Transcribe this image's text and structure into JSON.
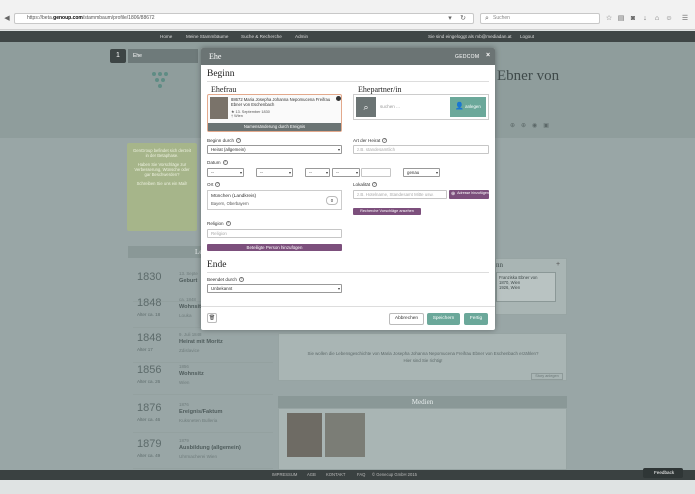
{
  "browser": {
    "url_prefix": "https://beta.",
    "url_domain": "genoup.com",
    "url_path": "/stammbaum/profile/1806/88672",
    "search_placeholder": "Suchen"
  },
  "site_nav": {
    "items": [
      "Home",
      "Meine Stammbäume",
      "Suche & Recherche",
      "Admin"
    ],
    "logged_in_text": "Sie sind eingeloggt als mb@mediadan.at",
    "logout_label": "Logout"
  },
  "background": {
    "step_number": "1",
    "step_label": "Ehe",
    "person_heading": "Ebner von",
    "sidebar_text_1": "GenGroup befindet sich derzeit in der Betaphase.",
    "sidebar_text_2": "Haben Sie Vorschläge zur Verbesserung, Wünsche oder gar Beschwerden?",
    "sidebar_text_3": "Schreiben Sie uns ein Mail!",
    "lebenslauf_heading": "Leb",
    "partner_heading": "nn",
    "partner_card": "Franziska Ebner von",
    "partner_card_date": "1870, Wien",
    "partner_card_date2": "1926, Wien",
    "empty_story": "Sie wollen die Lebensgeschichte von Maria Josepha Johanna Nepomucena Freifrau Ebner von Eschenbach erzählen? Hier sind Sie richtig!",
    "story_edit_label": "Story anlegen",
    "media_heading": "Medien",
    "timeline": [
      {
        "year": "1830",
        "age": "",
        "date": "13. Septe",
        "event": "Geburt",
        "place": ""
      },
      {
        "year": "1848",
        "age": "Alter ca. 18",
        "date": "ca. 1848",
        "event": "Wohnsit",
        "place": "Louka"
      },
      {
        "year": "1848",
        "age": "Alter 17",
        "date": "9. Juli 1848",
        "event": "Heirat mit Moritz",
        "place": "Zdislavice"
      },
      {
        "year": "1856",
        "age": "Alter ca. 26",
        "date": "1856",
        "event": "Wohnsitz",
        "place": "Wien"
      },
      {
        "year": "1876",
        "age": "Alter ca. 46",
        "date": "1876",
        "event": "Ereignis/Faktum",
        "place": "Kuksneten Bulleria"
      },
      {
        "year": "1879",
        "age": "Alter ca. 49",
        "date": "1879",
        "event": "Ausbildung (allgemein)",
        "place": "Uhrmacherei Wien"
      }
    ]
  },
  "modal": {
    "title": "Ehe",
    "brand": "GEDCOM",
    "close": "×",
    "beginn_heading": "Beginn",
    "ehefrau_heading": "Ehefrau",
    "ehefrau_card": {
      "name": "88672 Maria Josepha Johanna Nepomucena Freifrau Ebner von Eschenbach",
      "birth": "★ 13. September 1830",
      "death": "† Wien",
      "button": "Namensänderung durch Ereignis"
    },
    "partner_heading": "Ehepartner/in",
    "partner_search_placeholder": "suchen ...",
    "partner_create_label": "anlegen",
    "beginn_durch_label": "Beginn durch",
    "beginn_durch_value": "Heirat (allgemein)",
    "art_label": "Art der Heirat",
    "art_placeholder": "z.B. standesamtlich",
    "datum_label": "Datum",
    "datum_day": "--",
    "datum_month": "--",
    "datum_year": "--",
    "datum_extra": "--",
    "datum_precision": "genau",
    "ort_label": "Ort",
    "ort_value": "München (Landkreis)",
    "ort_sub": "Bayern, Oberbayern",
    "ort_badge": "0",
    "lokalitaet_label": "Lokalität",
    "lokalitaet_placeholder": "z.B. Hotelname, Standesamt Mitte usw.",
    "adresse_button": "Adresse hinzufügen",
    "recherche_button": "Recherche Vorschläge ansehen",
    "religion_label": "Religion",
    "religion_placeholder": "Religion",
    "beteiligte_button": "Beteiligte Person hinzufügen",
    "ende_heading": "Ende",
    "beendet_label": "Beendet durch",
    "beendet_value": "Unbekannt",
    "delete_icon": "🗑",
    "cancel": "Abbrechen",
    "save": "Speichern",
    "done": "Fertig"
  },
  "footer": {
    "items": [
      "IMPRESSUM",
      "AGB",
      "KONTAKT",
      "FAQ",
      "© Genecup GmbH 2015"
    ],
    "feedback": "Feedback"
  },
  "colors": {
    "accent": "#6ba89a",
    "purple": "#7c4f7c",
    "overlay": "#99a6a6",
    "modal_header": "#6b7474"
  }
}
